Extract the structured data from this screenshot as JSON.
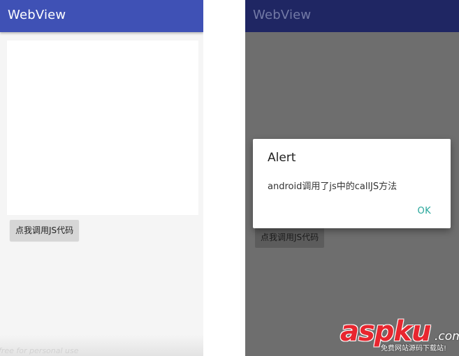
{
  "left_screen": {
    "appbar": {
      "title": "WebView"
    },
    "js_button": {
      "label": "点我调用JS代码"
    },
    "watermark": "free for personal use"
  },
  "right_screen": {
    "appbar": {
      "title": "WebView"
    },
    "js_button": {
      "label": "点我调用JS代码"
    },
    "dialog": {
      "title": "Alert",
      "message": "android调用了js中的callJS方法",
      "ok_label": "OK"
    }
  },
  "logo": {
    "main": "aspku",
    "suffix": ".com",
    "slogan": "免费网站源码下载站!"
  },
  "colors": {
    "primary": "#3f51b5",
    "primary_dimmed": "#1f2663",
    "scrim": "#6e6e6e",
    "dialog_accent": "#26a69a",
    "logo_red": "#e8262f"
  }
}
